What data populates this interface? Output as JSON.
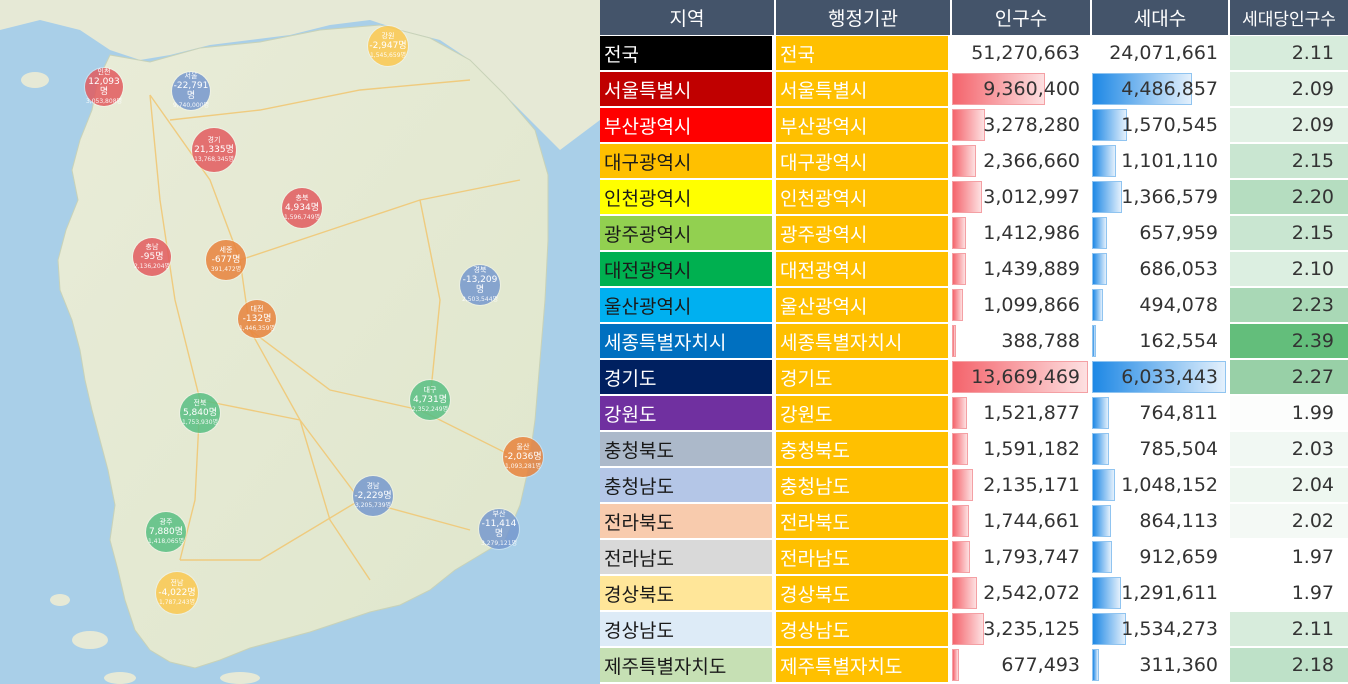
{
  "table": {
    "headers": [
      "지역",
      "행정기관",
      "인구수",
      "세대수",
      "세대당인구수"
    ],
    "rows": [
      {
        "region": "전국",
        "org": "전국",
        "pop": "51,270,663",
        "hh": "24,071,661",
        "ratio": "2.11",
        "pop_value": 51270663,
        "hh_value": 24071661,
        "region_bg": "#000000",
        "region_fg": "#ffffff",
        "ratio_bg": "#d7ecdc",
        "bars": false
      },
      {
        "region": "서울특별시",
        "org": "서울특별시",
        "pop": "9,360,400",
        "hh": "4,486,857",
        "ratio": "2.09",
        "pop_value": 9360400,
        "hh_value": 4486857,
        "region_bg": "#c00000",
        "region_fg": "#ffffff",
        "ratio_bg": "#e2f1e5",
        "bars": true
      },
      {
        "region": "부산광역시",
        "org": "부산광역시",
        "pop": "3,278,280",
        "hh": "1,570,545",
        "ratio": "2.09",
        "pop_value": 3278280,
        "hh_value": 1570545,
        "region_bg": "#ff0000",
        "region_fg": "#ffffff",
        "ratio_bg": "#e2f1e5",
        "bars": true
      },
      {
        "region": "대구광역시",
        "org": "대구광역시",
        "pop": "2,366,660",
        "hh": "1,101,110",
        "ratio": "2.15",
        "pop_value": 2366660,
        "hh_value": 1101110,
        "region_bg": "#ffc000",
        "region_fg": "#1a1a1a",
        "ratio_bg": "#c9e6d1",
        "bars": true
      },
      {
        "region": "인천광역시",
        "org": "인천광역시",
        "pop": "3,012,997",
        "hh": "1,366,579",
        "ratio": "2.20",
        "pop_value": 3012997,
        "hh_value": 1366579,
        "region_bg": "#ffff00",
        "region_fg": "#1a1a1a",
        "ratio_bg": "#b5ddc0",
        "bars": true
      },
      {
        "region": "광주광역시",
        "org": "광주광역시",
        "pop": "1,412,986",
        "hh": "657,959",
        "ratio": "2.15",
        "pop_value": 1412986,
        "hh_value": 657959,
        "region_bg": "#92d050",
        "region_fg": "#1a1a1a",
        "ratio_bg": "#c9e6d1",
        "bars": true
      },
      {
        "region": "대전광역시",
        "org": "대전광역시",
        "pop": "1,439,889",
        "hh": "686,053",
        "ratio": "2.10",
        "pop_value": 1439889,
        "hh_value": 686053,
        "region_bg": "#00b050",
        "region_fg": "#1a1a1a",
        "ratio_bg": "#dcefe1",
        "bars": true
      },
      {
        "region": "울산광역시",
        "org": "울산광역시",
        "pop": "1,099,866",
        "hh": "494,078",
        "ratio": "2.23",
        "pop_value": 1099866,
        "hh_value": 494078,
        "region_bg": "#00b0f0",
        "region_fg": "#1a1a1a",
        "ratio_bg": "#a9d8b6",
        "bars": true
      },
      {
        "region": "세종특별자치시",
        "org": "세종특별자치시",
        "pop": "388,788",
        "hh": "162,554",
        "ratio": "2.39",
        "pop_value": 388788,
        "hh_value": 162554,
        "region_bg": "#0070c0",
        "region_fg": "#ffffff",
        "ratio_bg": "#63be7b",
        "bars": true
      },
      {
        "region": "경기도",
        "org": "경기도",
        "pop": "13,669,469",
        "hh": "6,033,443",
        "ratio": "2.27",
        "pop_value": 13669469,
        "hh_value": 6033443,
        "region_bg": "#002060",
        "region_fg": "#ffffff",
        "ratio_bg": "#98d0a7",
        "bars": true
      },
      {
        "region": "강원도",
        "org": "강원도",
        "pop": "1,521,877",
        "hh": "764,811",
        "ratio": "1.99",
        "pop_value": 1521877,
        "hh_value": 764811,
        "region_bg": "#7030a0",
        "region_fg": "#ffffff",
        "ratio_bg": "#fcfdfc",
        "bars": true
      },
      {
        "region": "충청북도",
        "org": "충청북도",
        "pop": "1,591,182",
        "hh": "785,504",
        "ratio": "2.03",
        "pop_value": 1591182,
        "hh_value": 785504,
        "region_bg": "#acb9ca",
        "region_fg": "#1a1a1a",
        "ratio_bg": "#f1f8f3",
        "bars": true
      },
      {
        "region": "충청남도",
        "org": "충청남도",
        "pop": "2,135,171",
        "hh": "1,048,152",
        "ratio": "2.04",
        "pop_value": 2135171,
        "hh_value": 1048152,
        "region_bg": "#b4c6e7",
        "region_fg": "#1a1a1a",
        "ratio_bg": "#eef7f0",
        "bars": true
      },
      {
        "region": "전라북도",
        "org": "전라북도",
        "pop": "1,744,661",
        "hh": "864,113",
        "ratio": "2.02",
        "pop_value": 1744661,
        "hh_value": 864113,
        "region_bg": "#f8cbad",
        "region_fg": "#1a1a1a",
        "ratio_bg": "#f4f9f5",
        "bars": true
      },
      {
        "region": "전라남도",
        "org": "전라남도",
        "pop": "1,793,747",
        "hh": "912,659",
        "ratio": "1.97",
        "pop_value": 1793747,
        "hh_value": 912659,
        "region_bg": "#d9d9d9",
        "region_fg": "#1a1a1a",
        "ratio_bg": "#ffffff",
        "bars": true
      },
      {
        "region": "경상북도",
        "org": "경상북도",
        "pop": "2,542,072",
        "hh": "1,291,611",
        "ratio": "1.97",
        "pop_value": 2542072,
        "hh_value": 1291611,
        "region_bg": "#ffe699",
        "region_fg": "#1a1a1a",
        "ratio_bg": "#ffffff",
        "bars": true
      },
      {
        "region": "경상남도",
        "org": "경상남도",
        "pop": "3,235,125",
        "hh": "1,534,273",
        "ratio": "2.11",
        "pop_value": 3235125,
        "hh_value": 1534273,
        "region_bg": "#ddebf7",
        "region_fg": "#1a1a1a",
        "ratio_bg": "#d7ecdc",
        "bars": true
      },
      {
        "region": "제주특별자치도",
        "org": "제주특별자치도",
        "pop": "677,493",
        "hh": "311,360",
        "ratio": "2.18",
        "pop_value": 677493,
        "hh_value": 311360,
        "region_bg": "#c6e0b4",
        "region_fg": "#1a1a1a",
        "ratio_bg": "#bee1c8",
        "bars": true
      }
    ]
  },
  "map": {
    "bubbles": [
      {
        "name": "인천",
        "change": "12,093명",
        "pop": "3,053,808명",
        "color": "red"
      },
      {
        "name": "서울",
        "change": "-22,791명",
        "pop": "9,740,000명",
        "color": "blue"
      },
      {
        "name": "강원",
        "change": "-2,947명",
        "pop": "1,545,659명",
        "color": "yellow"
      },
      {
        "name": "경기",
        "change": "21,335명",
        "pop": "13,768,345명",
        "color": "red"
      },
      {
        "name": "충북",
        "change": "4,934명",
        "pop": "1,596,749명",
        "color": "red"
      },
      {
        "name": "충남",
        "change": "-95명",
        "pop": "2,136,204명",
        "color": "red"
      },
      {
        "name": "세종",
        "change": "-677명",
        "pop": "391,472명",
        "color": "orange"
      },
      {
        "name": "경북",
        "change": "-13,209명",
        "pop": "2,503,544명",
        "color": "blue"
      },
      {
        "name": "대전",
        "change": "-132명",
        "pop": "1,446,359명",
        "color": "orange"
      },
      {
        "name": "대구",
        "change": "4,731명",
        "pop": "2,352,249명",
        "color": "green"
      },
      {
        "name": "전북",
        "change": "5,840명",
        "pop": "1,753,930명",
        "color": "green"
      },
      {
        "name": "울산",
        "change": "-2,036명",
        "pop": "1,093,281명",
        "color": "orange"
      },
      {
        "name": "경남",
        "change": "-2,229명",
        "pop": "3,205,739명",
        "color": "blue"
      },
      {
        "name": "부산",
        "change": "-11,414명",
        "pop": "3,279,121명",
        "color": "blue"
      },
      {
        "name": "광주",
        "change": "7,880명",
        "pop": "1,418,065명",
        "color": "green"
      },
      {
        "name": "전남",
        "change": "-4,022명",
        "pop": "1,787,243명",
        "color": "yellow"
      }
    ]
  }
}
